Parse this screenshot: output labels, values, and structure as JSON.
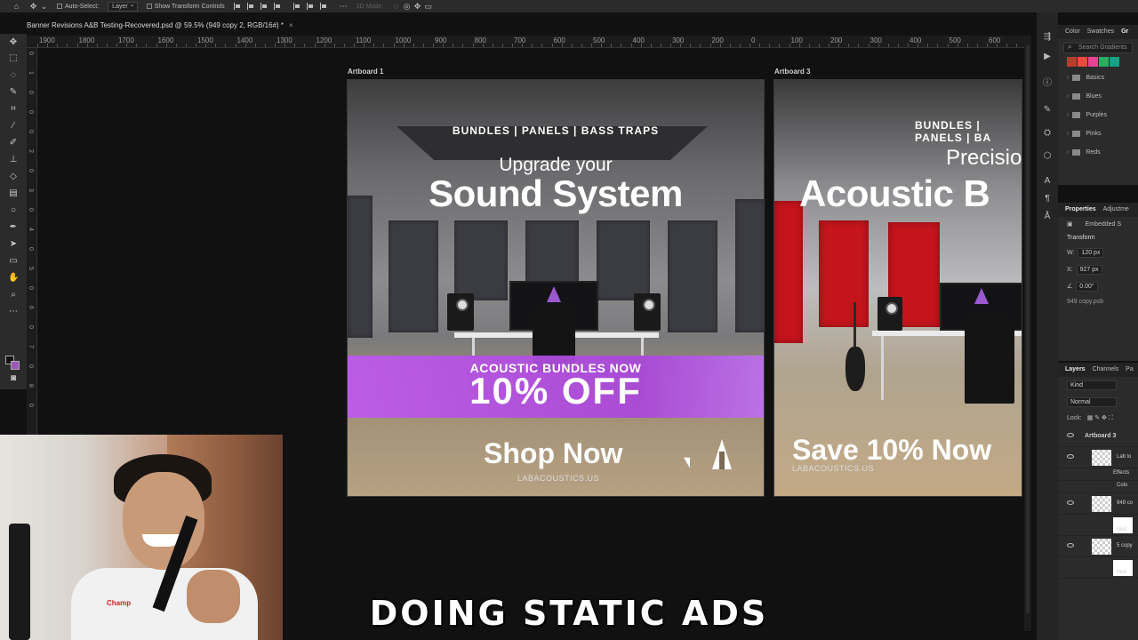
{
  "options_bar": {
    "auto_select_label": "Auto-Select:",
    "auto_select_target": "Layer",
    "show_transform_label": "Show Transform Controls",
    "mode_3d_label": "3D Mode:"
  },
  "document": {
    "tab_title": "Banner Revisions A&B Testing-Recovered.psd @ 59.5% (949 copy 2, RGB/16#) *",
    "close": "×"
  },
  "ruler": {
    "h_labels": [
      "1900",
      "1800",
      "1700",
      "1600",
      "1500",
      "1400",
      "1300",
      "1200",
      "1100",
      "1000",
      "900",
      "800",
      "700",
      "600",
      "500",
      "400",
      "300",
      "200",
      "0",
      "100",
      "200",
      "300",
      "400",
      "500",
      "600"
    ],
    "v_labels": [
      "0",
      "1",
      "0",
      "0",
      "0",
      "2",
      "0",
      "3",
      "0",
      "4",
      "0",
      "5",
      "0",
      "6",
      "0",
      "7",
      "0",
      "8",
      "0"
    ]
  },
  "artboard1": {
    "label": "Artboard 1",
    "kicker": "BUNDLES | PANELS | BASS TRAPS",
    "subhead": "Upgrade your",
    "headline": "Sound System",
    "band_top": "ACOUSTIC BUNDLES NOW",
    "band_big": "10% OFF",
    "cta": "Shop Now",
    "url": "LABACOUSTICS.US"
  },
  "artboard3": {
    "label": "Artboard 3",
    "kicker": "BUNDLES | PANELS | BA",
    "subhead": "Precisio",
    "headline": "Acoustic B",
    "cta": "Save 10% Now",
    "url": "LABACOUSTICS.US"
  },
  "panels": {
    "top_tabs": [
      "Color",
      "Swatches",
      "Gr"
    ],
    "search_placeholder": "Search Gradients",
    "gradient_colors": [
      "#c0392b",
      "#e74c3c",
      "#e84393",
      "#27ae60",
      "#16a085"
    ],
    "folders": [
      "Basics",
      "Blues",
      "Purples",
      "Pinks",
      "Reds"
    ],
    "properties_tabs": [
      "Properties",
      "Adjustme"
    ],
    "embedded_label": "Embedded S",
    "transform_label": "Transform",
    "w_label": "W:",
    "w_value": "120 px",
    "x_label": "X:",
    "x_value": "927 px",
    "angle_value": "0.00°",
    "file_name": "949 copy.psb",
    "layers_tabs": [
      "Layers",
      "Channels",
      "Pa"
    ],
    "kind_label": "Kind",
    "blend_mode": "Normal",
    "lock_label": "Lock:",
    "layers": [
      "Artboard 3",
      "Lab lo",
      "Effects",
      "Colo",
      "949 co",
      "Moti",
      "5 copy",
      "Moti"
    ]
  },
  "webcam": {
    "shirt_text": "Champ"
  },
  "caption": "DOING STATIC ADS"
}
